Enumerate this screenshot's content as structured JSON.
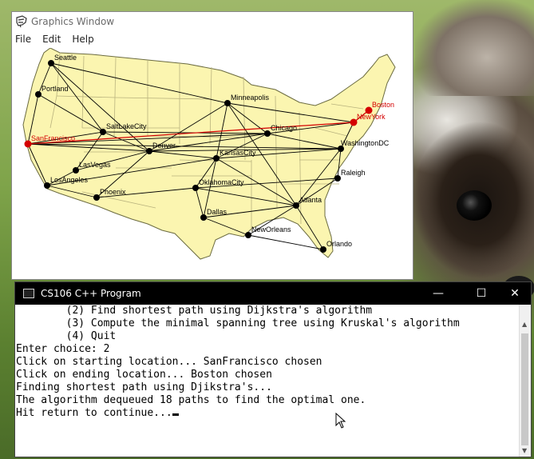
{
  "graphics_window": {
    "title": "Graphics Window",
    "menu": [
      "File",
      "Edit",
      "Help"
    ],
    "map": {
      "land_color": "#fbf5b0",
      "water_color": "#ffffff",
      "highlight_color": "#d40000",
      "cities": [
        {
          "name": "Seattle",
          "highlight": false
        },
        {
          "name": "Portland",
          "highlight": false
        },
        {
          "name": "SanFrancisco",
          "highlight": true
        },
        {
          "name": "LosAngeles",
          "highlight": false
        },
        {
          "name": "LasVegas",
          "highlight": false
        },
        {
          "name": "SaltLakeCity",
          "highlight": false
        },
        {
          "name": "Phoenix",
          "highlight": false
        },
        {
          "name": "Denver",
          "highlight": false
        },
        {
          "name": "Minneapolis",
          "highlight": false
        },
        {
          "name": "Chicago",
          "highlight": false
        },
        {
          "name": "KansasCity",
          "highlight": false
        },
        {
          "name": "OklahomaCity",
          "highlight": false
        },
        {
          "name": "Dallas",
          "highlight": false
        },
        {
          "name": "NewOrleans",
          "highlight": false
        },
        {
          "name": "Atlanta",
          "highlight": false
        },
        {
          "name": "Orlando",
          "highlight": false
        },
        {
          "name": "Raleigh",
          "highlight": false
        },
        {
          "name": "WashingtonDC",
          "highlight": false
        },
        {
          "name": "NewYork",
          "highlight": true
        },
        {
          "name": "Boston",
          "highlight": true
        }
      ]
    }
  },
  "console_window": {
    "title": "CS106 C++ Program",
    "controls": {
      "minimize": "—",
      "maximize": "☐",
      "close": "✕"
    },
    "lines": [
      "        (2) Find shortest path using Dijkstra's algorithm",
      "        (3) Compute the minimal spanning tree using Kruskal's algorithm",
      "        (4) Quit",
      "Enter choice: 2",
      "Click on starting location... SanFrancisco chosen",
      "",
      "Click on ending location... Boston chosen",
      "",
      "Finding shortest path using Djikstra's...",
      "The algorithm dequeued 18 paths to find the optimal one.",
      "Hit return to continue..."
    ]
  }
}
